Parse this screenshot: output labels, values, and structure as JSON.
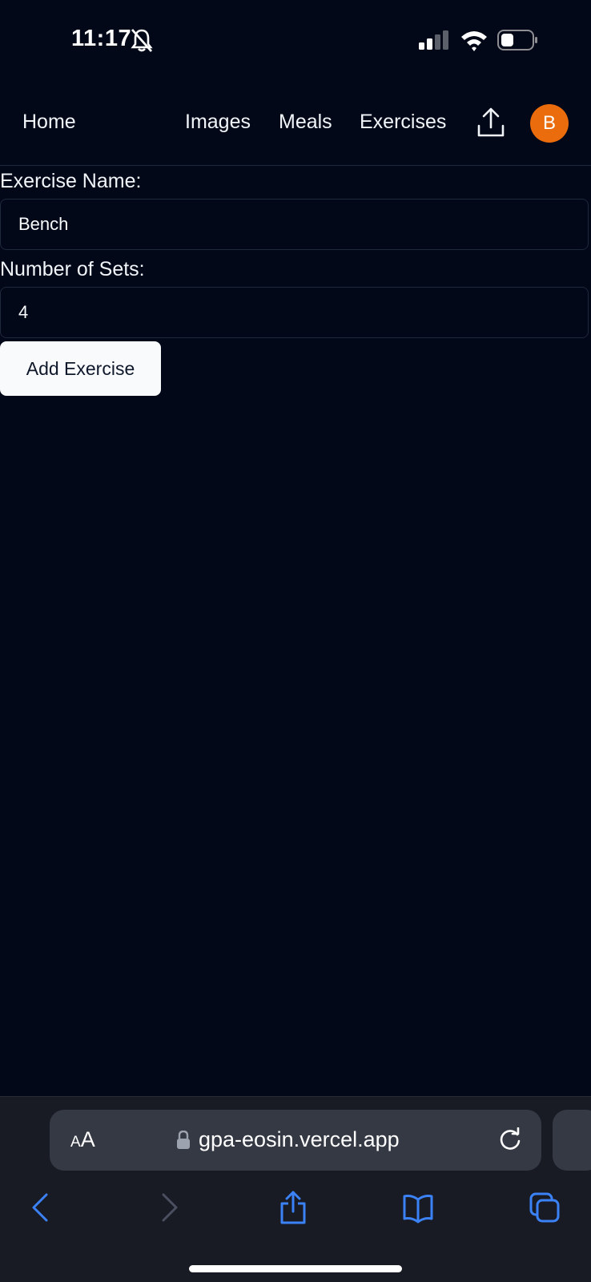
{
  "status_bar": {
    "time": "11:17",
    "icons": [
      "bell-slash-icon",
      "signal-icon",
      "wifi-icon",
      "battery-icon"
    ]
  },
  "nav": {
    "home": "Home",
    "images": "Images",
    "meals": "Meals",
    "exercises": "Exercises",
    "upload_icon": "upload-icon",
    "avatar_initial": "B",
    "avatar_color": "#ea6c0c"
  },
  "form": {
    "exercise_name_label": "Exercise Name:",
    "exercise_name_value": "Bench",
    "sets_label": "Number of Sets:",
    "sets_value": "4",
    "submit_label": "Add Exercise"
  },
  "browser": {
    "aa_small": "A",
    "aa_big": "A",
    "url": "gpa-eosin.vercel.app",
    "icons": [
      "lock-icon",
      "reload-icon",
      "back-icon",
      "forward-icon",
      "share-icon",
      "bookmarks-icon",
      "tabs-icon"
    ],
    "accent": "#3b82f6"
  },
  "colors": {
    "background": "#020817",
    "foreground": "#f8fafc",
    "border": "#1e293b"
  }
}
